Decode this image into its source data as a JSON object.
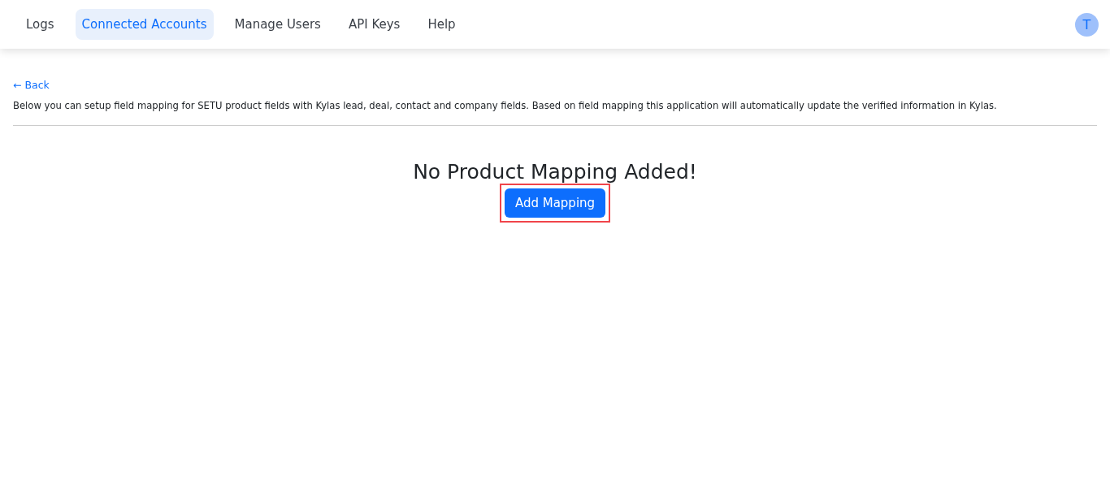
{
  "nav": {
    "tabs": [
      {
        "label": "Logs",
        "selected": false
      },
      {
        "label": "Connected Accounts",
        "selected": true
      },
      {
        "label": "Manage Users",
        "selected": false
      },
      {
        "label": "API Keys",
        "selected": false
      },
      {
        "label": "Help",
        "selected": false
      }
    ],
    "avatar": "T"
  },
  "back_link": {
    "arrow": "←",
    "label": "Back"
  },
  "description": "Below you can setup field mapping for SETU product fields with Kylas lead, deal, contact and company fields. Based on field mapping this application will automatically update the verified information in Kylas.",
  "empty_state": {
    "title": "No Product Mapping Added!",
    "button": {
      "label": "Add Mapping",
      "highlighted": true
    }
  }
}
